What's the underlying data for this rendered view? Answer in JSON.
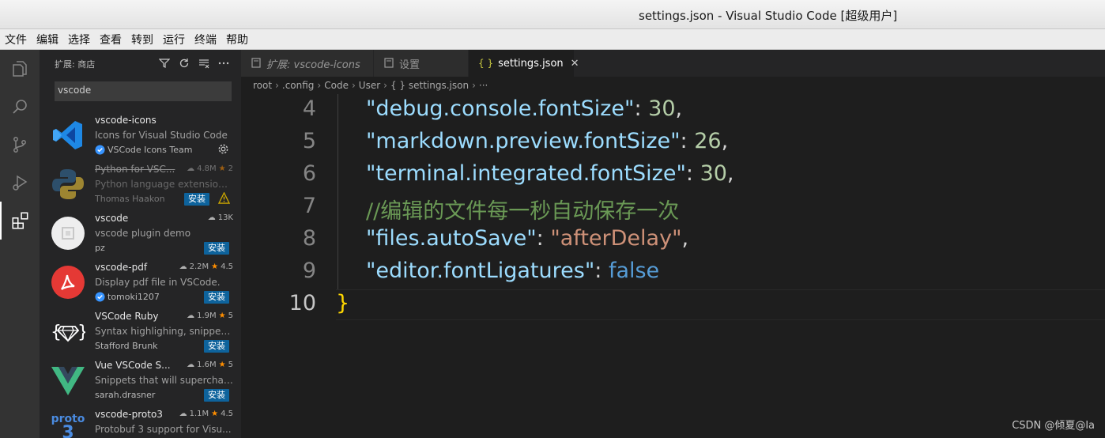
{
  "window": {
    "title": "settings.json - Visual Studio Code [超级用户]"
  },
  "menu": [
    "文件",
    "编辑",
    "选择",
    "查看",
    "转到",
    "运行",
    "终端",
    "帮助"
  ],
  "activity_bar": {
    "icons": [
      "files-icon",
      "search-icon",
      "source-control-icon",
      "run-debug-icon",
      "extensions-icon"
    ],
    "active": "extensions-icon"
  },
  "sidebar": {
    "header": "扩展: 商店",
    "search": {
      "value": "vscode"
    },
    "extensions": [
      {
        "name": "vscode-icons",
        "description": "Icons for Visual Studio Code",
        "publisher": "VSCode Icons Team",
        "verified": true,
        "downloads": "",
        "rating": "",
        "action": "",
        "logo": "vscode-icons-logo"
      },
      {
        "name": "Python for VSC...",
        "description": "Python language extension f...",
        "publisher": "Thomas Haakon",
        "verified": false,
        "downloads": "4.8M",
        "rating": "2",
        "action": "安装",
        "logo": "python-logo",
        "deprecated": true
      },
      {
        "name": "vscode",
        "description": "vscode plugin demo",
        "publisher": "pz",
        "verified": false,
        "downloads": "13K",
        "rating": "",
        "action": "安装",
        "logo": "generic-logo"
      },
      {
        "name": "vscode-pdf",
        "description": "Display pdf file in VSCode.",
        "publisher": "tomoki1207",
        "verified": true,
        "downloads": "2.2M",
        "rating": "4.5",
        "action": "安装",
        "logo": "pdf-logo"
      },
      {
        "name": "VSCode Ruby",
        "description": "Syntax highlighing, snippet, ...",
        "publisher": "Stafford Brunk",
        "verified": false,
        "downloads": "1.9M",
        "rating": "5",
        "action": "安装",
        "logo": "ruby-logo"
      },
      {
        "name": "Vue VSCode S...",
        "description": "Snippets that will superchar...",
        "publisher": "sarah.drasner",
        "verified": false,
        "downloads": "1.6M",
        "rating": "5",
        "action": "安装",
        "logo": "vue-logo"
      },
      {
        "name": "vscode-proto3",
        "description": "Protobuf 3 support for Visu...",
        "publisher": "",
        "verified": false,
        "downloads": "1.1M",
        "rating": "4.5",
        "action": "",
        "logo": "proto-logo"
      }
    ],
    "logo_text": {
      "proto": "proto",
      "proto3": "3"
    }
  },
  "tabs": [
    {
      "label": "扩展: vscode-icons",
      "icon": "extension-tab-icon",
      "active": false
    },
    {
      "label": "设置",
      "icon": "file-tab-icon",
      "active": false
    },
    {
      "label": "settings.json",
      "icon": "json-braces-icon",
      "active": true
    }
  ],
  "breadcrumb": [
    "root",
    ".config",
    "Code",
    "User",
    "{ } settings.json",
    "···"
  ],
  "editor": {
    "lines": [
      {
        "num": "4",
        "tokens": [
          [
            "k",
            "\"debug.console.fontSize\""
          ],
          [
            "p",
            ": "
          ],
          [
            "n",
            "30"
          ],
          [
            "p",
            ","
          ]
        ]
      },
      {
        "num": "5",
        "tokens": [
          [
            "k",
            "\"markdown.preview.fontSize\""
          ],
          [
            "p",
            ": "
          ],
          [
            "n",
            "26"
          ],
          [
            "p",
            ","
          ]
        ]
      },
      {
        "num": "6",
        "tokens": [
          [
            "k",
            "\"terminal.integrated.fontSize\""
          ],
          [
            "p",
            ": "
          ],
          [
            "n",
            "30"
          ],
          [
            "p",
            ","
          ]
        ]
      },
      {
        "num": "7",
        "tokens": [
          [
            "c",
            "//编辑的文件每一秒自动保存一次"
          ]
        ]
      },
      {
        "num": "8",
        "tokens": [
          [
            "k",
            "\"files.autoSave\""
          ],
          [
            "p",
            ": "
          ],
          [
            "s",
            "\"afterDelay\""
          ],
          [
            "p",
            ","
          ]
        ]
      },
      {
        "num": "9",
        "tokens": [
          [
            "k",
            "\"editor.fontLigatures\""
          ],
          [
            "p",
            ": "
          ],
          [
            "b",
            "false"
          ]
        ]
      },
      {
        "num": "10",
        "tokens": [
          [
            "brace",
            "}"
          ]
        ],
        "current": true
      }
    ]
  },
  "watermark": "CSDN @倾夏@la"
}
